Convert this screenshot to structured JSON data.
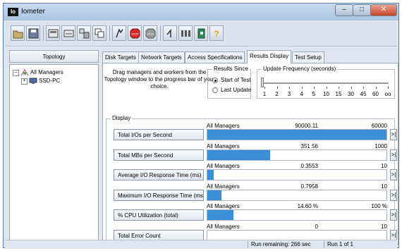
{
  "window": {
    "title": "Iometer",
    "icon_text": "Io",
    "controls": [
      "minimize",
      "maximize",
      "close"
    ]
  },
  "toolbar": {
    "buttons": [
      {
        "name": "open-icon"
      },
      {
        "name": "save-icon"
      },
      {
        "name": "new-disk-worker-icon"
      },
      {
        "name": "new-network-worker-icon"
      },
      {
        "name": "add-manager-icon"
      },
      {
        "name": "copy-worker-icon"
      },
      {
        "name": "start-tests-icon"
      },
      {
        "name": "stop-icon"
      },
      {
        "name": "stop-all-icon"
      },
      {
        "name": "reset-workers-icon"
      },
      {
        "name": "disconnect-icon"
      },
      {
        "name": "exit-icon"
      },
      {
        "name": "about-icon"
      }
    ],
    "stop_label": "STOP",
    "stop_all_label": "STOP",
    "about_glyph": "?"
  },
  "topology": {
    "header": "Topology",
    "root": "All Managers",
    "child": "SSD-PC"
  },
  "tabs": [
    {
      "label": "Disk Targets"
    },
    {
      "label": "Network Targets"
    },
    {
      "label": "Access Specifications"
    },
    {
      "label": "Results Display",
      "active": true
    },
    {
      "label": "Test Setup"
    }
  ],
  "results": {
    "hint": "Drag managers and workers from the Topology window to the progress bar of your choice.",
    "results_since": {
      "label": "Results Since",
      "options": [
        {
          "label": "Start of Test",
          "selected": true
        },
        {
          "label": "Last Update",
          "selected": false
        }
      ]
    },
    "update_frequency": {
      "label": "Update Frequency (seconds)",
      "labels": [
        "1",
        "2",
        "3",
        "4",
        "5",
        "10",
        "15",
        "30",
        "45",
        "60",
        "oo"
      ],
      "selected": "1"
    },
    "display_label": "Display",
    "rows": [
      {
        "button": "Total I/Os per Second",
        "manager": "All Managers",
        "value": "90000.11",
        "max": "60000",
        "fill": 1.0
      },
      {
        "button": "Total MBs per Second",
        "manager": "All Managers",
        "value": "351.56",
        "max": "1000",
        "fill": 0.3516
      },
      {
        "button": "Average I/O Response Time (ms)",
        "manager": "All Managers",
        "value": "0.3553",
        "max": "10",
        "fill": 0.0355
      },
      {
        "button": "Maximum I/O Response Time (ms)",
        "manager": "All Managers",
        "value": "0.7958",
        "max": "10",
        "fill": 0.0796
      },
      {
        "button": "% CPU Utilization (total)",
        "manager": "All Managers",
        "value": "14.60 %",
        "max": "100 %",
        "fill": 0.146
      },
      {
        "button": "Total Error Count",
        "manager": "All Managers",
        "value": "0",
        "max": "10",
        "fill": 0
      }
    ],
    "row_arrow": ">|"
  },
  "status": {
    "remaining": "Run remaining: 266 sec",
    "run": "Run 1 of 1"
  },
  "colors": {
    "bar": "#3a8fd6",
    "titlebar": "#a9c4e2",
    "close": "#c4452c"
  }
}
